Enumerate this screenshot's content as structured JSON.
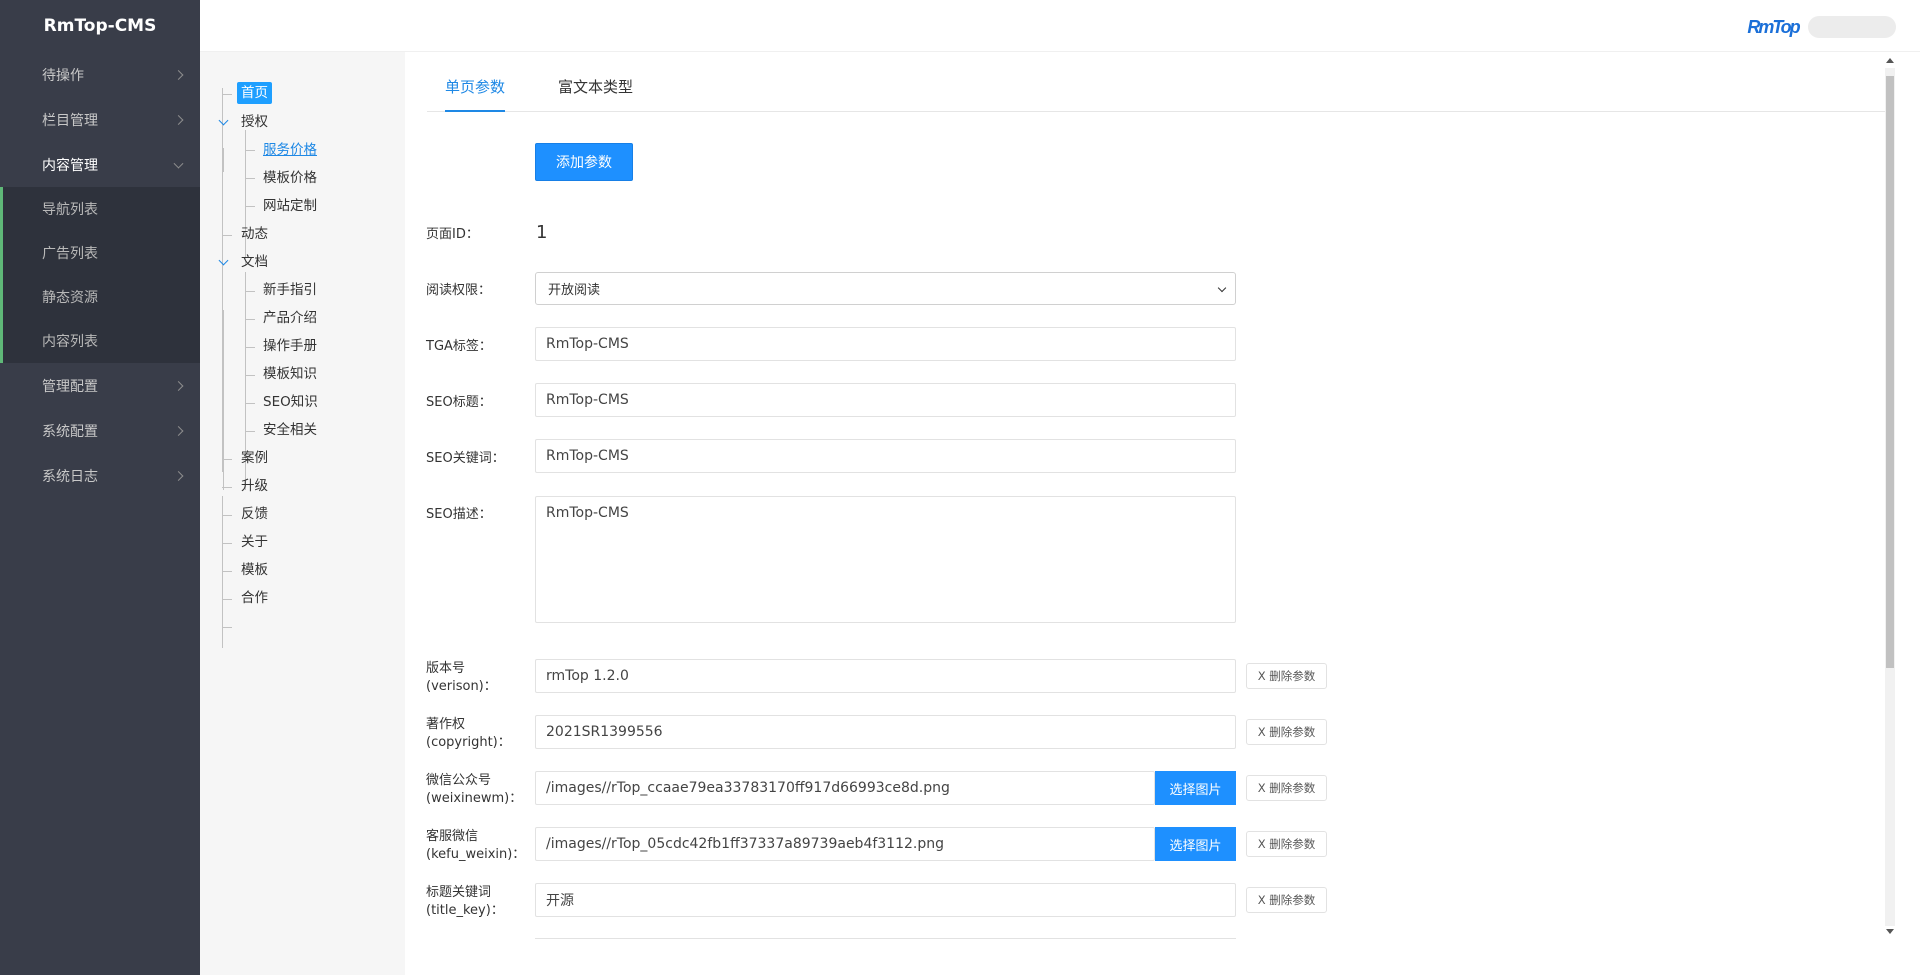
{
  "app": {
    "title": "RmTop-CMS",
    "brand_logo_text": "RmTop"
  },
  "sidebar": {
    "items": [
      {
        "label": "待操作"
      },
      {
        "label": "栏目管理"
      },
      {
        "label": "内容管理"
      },
      {
        "label": "管理配置"
      },
      {
        "label": "系统配置"
      },
      {
        "label": "系统日志"
      }
    ],
    "submenu": [
      {
        "label": "导航列表"
      },
      {
        "label": "广告列表"
      },
      {
        "label": "静态资源"
      },
      {
        "label": "内容列表"
      }
    ]
  },
  "tree": {
    "root": "首页",
    "nodes": [
      {
        "label": "授权"
      },
      {
        "label": "服务价格"
      },
      {
        "label": "模板价格"
      },
      {
        "label": "网站定制"
      },
      {
        "label": "动态"
      },
      {
        "label": "文档"
      },
      {
        "label": "新手指引"
      },
      {
        "label": "产品介绍"
      },
      {
        "label": "操作手册"
      },
      {
        "label": "模板知识"
      },
      {
        "label": "SEO知识"
      },
      {
        "label": "安全相关"
      },
      {
        "label": "案例"
      },
      {
        "label": "升级"
      },
      {
        "label": "反馈"
      },
      {
        "label": "关于"
      },
      {
        "label": "模板"
      },
      {
        "label": "合作"
      }
    ]
  },
  "tabs": [
    {
      "label": "单页参数"
    },
    {
      "label": "富文本类型"
    }
  ],
  "form": {
    "add_button": "添加参数",
    "page_id": {
      "label": "页面ID：",
      "value": "1"
    },
    "read_permission": {
      "label": "阅读权限：",
      "value": "开放阅读"
    },
    "tga": {
      "label": "TGA标签：",
      "value": "RmTop-CMS"
    },
    "seo_title": {
      "label": "SEO标题：",
      "value": "RmTop-CMS"
    },
    "seo_keywords": {
      "label": "SEO关键词：",
      "value": "RmTop-CMS"
    },
    "seo_desc": {
      "label": "SEO描述：",
      "value": "RmTop-CMS"
    },
    "pick_image_label": "选择图片",
    "delete_label": "X 删除参数",
    "params": [
      {
        "label1": "版本号",
        "label2": "(verison)：",
        "value": "rmTop 1.2.0"
      },
      {
        "label1": "著作权",
        "label2": "(copyright)：",
        "value": "2021SR1399556"
      },
      {
        "label1": "微信公众号",
        "label2": "(weixinewm)：",
        "value": "/images//rTop_ccaae79ea33783170ff917d66993ce8d.png"
      },
      {
        "label1": "客服微信",
        "label2": "(kefu_weixin)：",
        "value": "/images//rTop_05cdc42fb1ff37337a89739aeb4f3112.png"
      },
      {
        "label1": "标题关键词",
        "label2": "(title_key)：",
        "value": "开源"
      }
    ]
  }
}
